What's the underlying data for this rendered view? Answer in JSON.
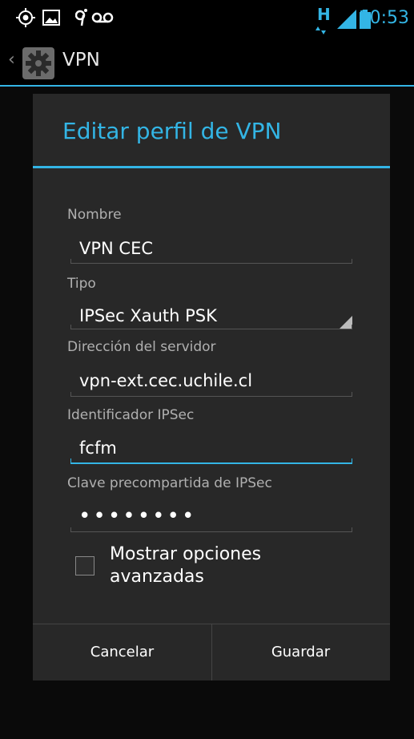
{
  "statusbar": {
    "time": "10:53",
    "network_label": "H",
    "icons": [
      "gps-icon",
      "image-notification-icon",
      "usb-debug-icon",
      "voicemail-icon",
      "signal-icon",
      "battery-icon"
    ]
  },
  "actionbar": {
    "title": "VPN",
    "back_icon": "back-caret-icon",
    "app_icon": "settings-gear-icon"
  },
  "dialog": {
    "title": "Editar perfil de VPN",
    "fields": {
      "name_label": "Nombre",
      "name_value": "VPN CEC",
      "type_label": "Tipo",
      "type_value": "IPSec Xauth PSK",
      "server_label": "Dirección del servidor",
      "server_value": "vpn-ext.cec.uchile.cl",
      "ipsec_id_label": "Identificador IPSec",
      "ipsec_id_value": "fcfm",
      "psk_label": "Clave precompartida de IPSec",
      "psk_value": "••••••••"
    },
    "advanced": {
      "label_line1": "Mostrar opciones",
      "label_line2": "avanzadas",
      "checked": false
    },
    "buttons": {
      "cancel": "Cancelar",
      "save": "Guardar"
    }
  },
  "colors": {
    "accent": "#33b5e5",
    "dialog_bg": "#282828",
    "screen_bg": "#000000"
  }
}
